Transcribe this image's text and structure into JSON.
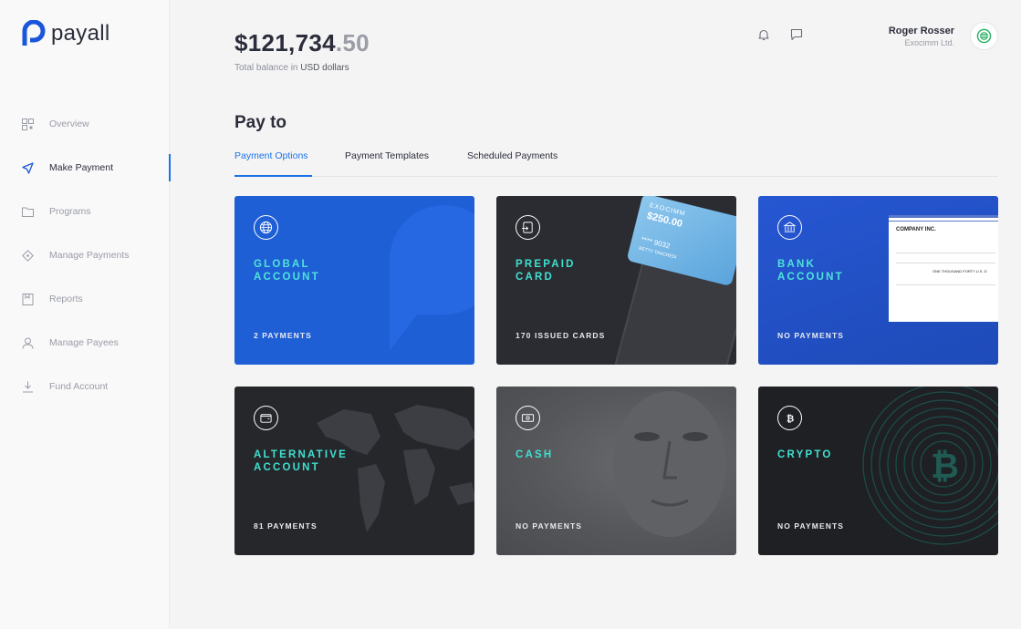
{
  "brand": {
    "name": "payall"
  },
  "sidebar": {
    "items": [
      {
        "label": "Overview",
        "icon": "grid-icon",
        "active": false
      },
      {
        "label": "Make Payment",
        "icon": "send-icon",
        "active": true
      },
      {
        "label": "Programs",
        "icon": "folder-icon",
        "active": false
      },
      {
        "label": "Manage Payments",
        "icon": "tag-icon",
        "active": false
      },
      {
        "label": "Reports",
        "icon": "report-icon",
        "active": false
      },
      {
        "label": "Manage Payees",
        "icon": "user-icon",
        "active": false
      },
      {
        "label": "Fund Account",
        "icon": "download-icon",
        "active": false
      }
    ]
  },
  "header": {
    "balance_main": "$121,734",
    "balance_cents": ".50",
    "balance_caption_prefix": "Total balance in ",
    "balance_currency": "USD dollars",
    "user_name": "Roger Rosser",
    "user_company": "Exocimm Ltd."
  },
  "payto": {
    "title": "Pay to",
    "tabs": [
      "Payment Options",
      "Payment Templates",
      "Scheduled Payments"
    ],
    "cards": [
      {
        "title": "GLOBAL\nACCOUNT",
        "subtitle": "2 PAYMENTS",
        "icon": "globe-icon"
      },
      {
        "title": "PREPAID\nCARD",
        "subtitle": "170 ISSUED CARDS",
        "icon": "card-icon"
      },
      {
        "title": "BANK\nACCOUNT",
        "subtitle": "NO PAYMENTS",
        "icon": "bank-icon"
      },
      {
        "title": "ALTERNATIVE\nACCOUNT",
        "subtitle": "81 PAYMENTS",
        "icon": "wallet-icon"
      },
      {
        "title": "CASH",
        "subtitle": "NO PAYMENTS",
        "icon": "cash-icon"
      },
      {
        "title": "CRYPTO",
        "subtitle": "NO PAYMENTS",
        "icon": "bitcoin-icon"
      }
    ],
    "prepaid_card_brand": "EXOCIMM",
    "prepaid_card_amount": "$250.00",
    "prepaid_card_number": "**** 9032",
    "prepaid_card_holder": "BETTY TANCREDI",
    "cheque_company": "COMPANY INC.",
    "cheque_amount_words": "ONE THOUSAND FORTY U.S. D"
  },
  "colors": {
    "accent": "#1a73e8",
    "teal": "#3fe0d0"
  }
}
